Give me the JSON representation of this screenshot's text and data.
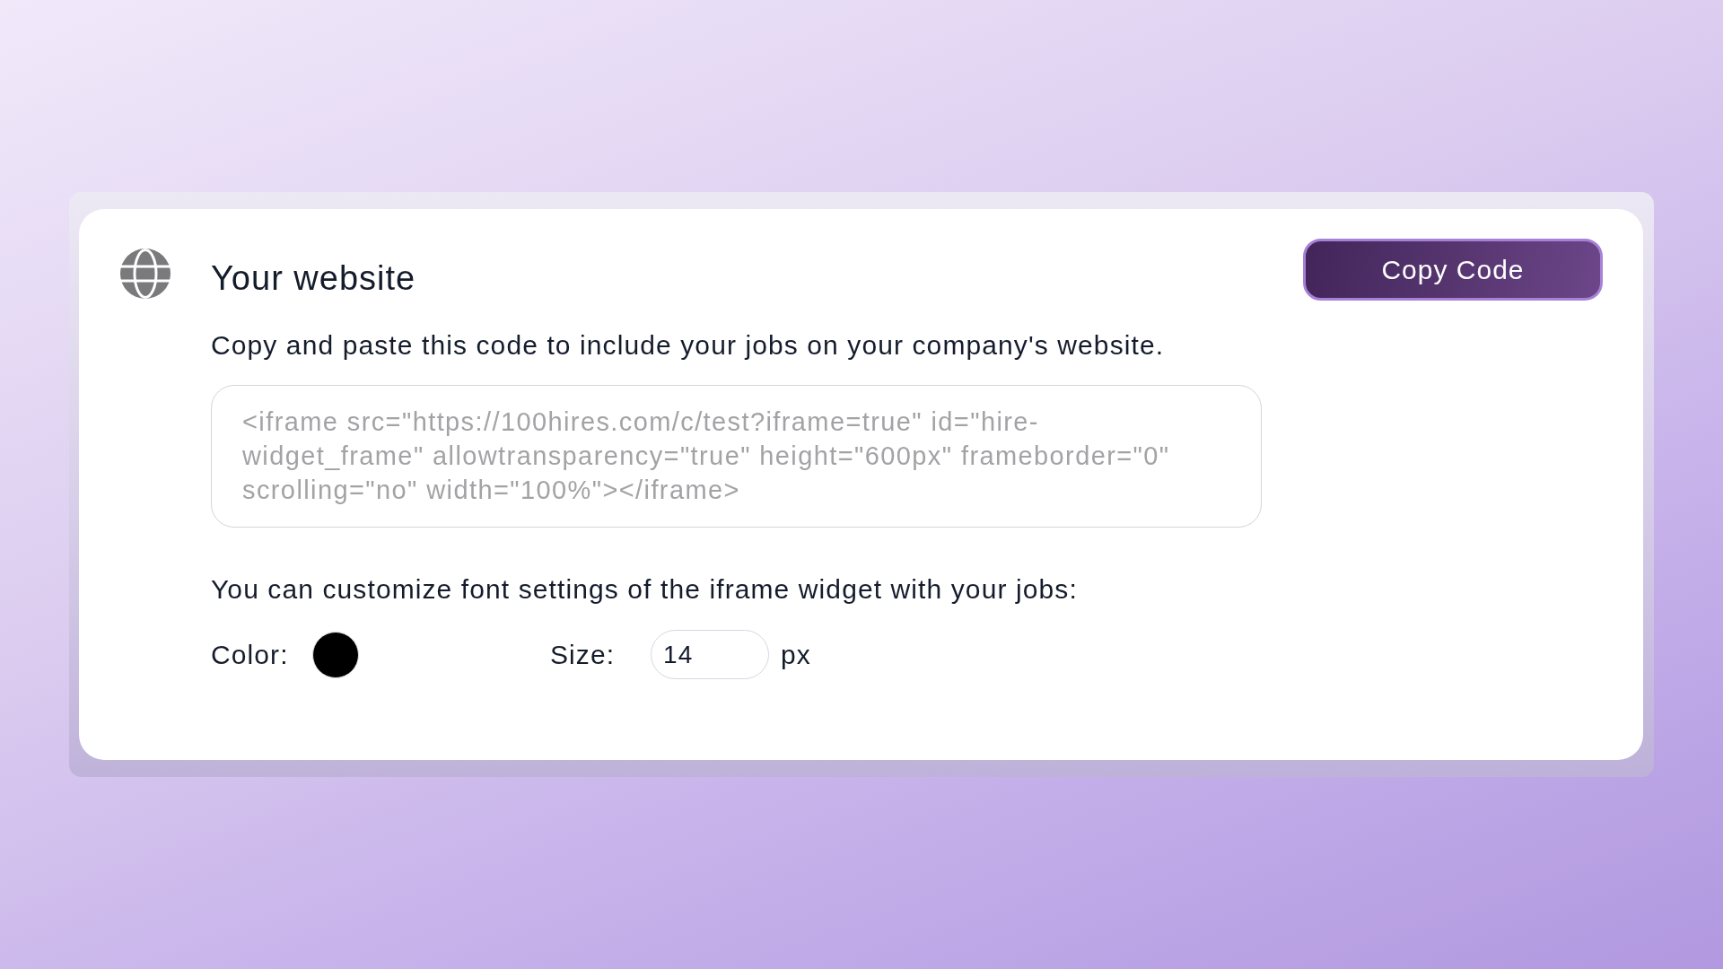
{
  "section": {
    "title": "Your website",
    "copy_button": "Copy Code",
    "description": "Copy and paste this code to include your jobs on your company's website.",
    "embed_code": "<iframe src=\"https://100hires.com/c/test?iframe=true\" id=\"hire-widget_frame\" allowtransparency=\"true\" height=\"600px\" frameborder=\"0\" scrolling=\"no\" width=\"100%\"></iframe>",
    "customize_hint": "You can customize font settings of the iframe widget with your jobs:",
    "font_settings": {
      "color_label": "Color:",
      "color": "#000000",
      "size_label": "Size:",
      "size_value": "14",
      "size_unit": "px"
    }
  }
}
